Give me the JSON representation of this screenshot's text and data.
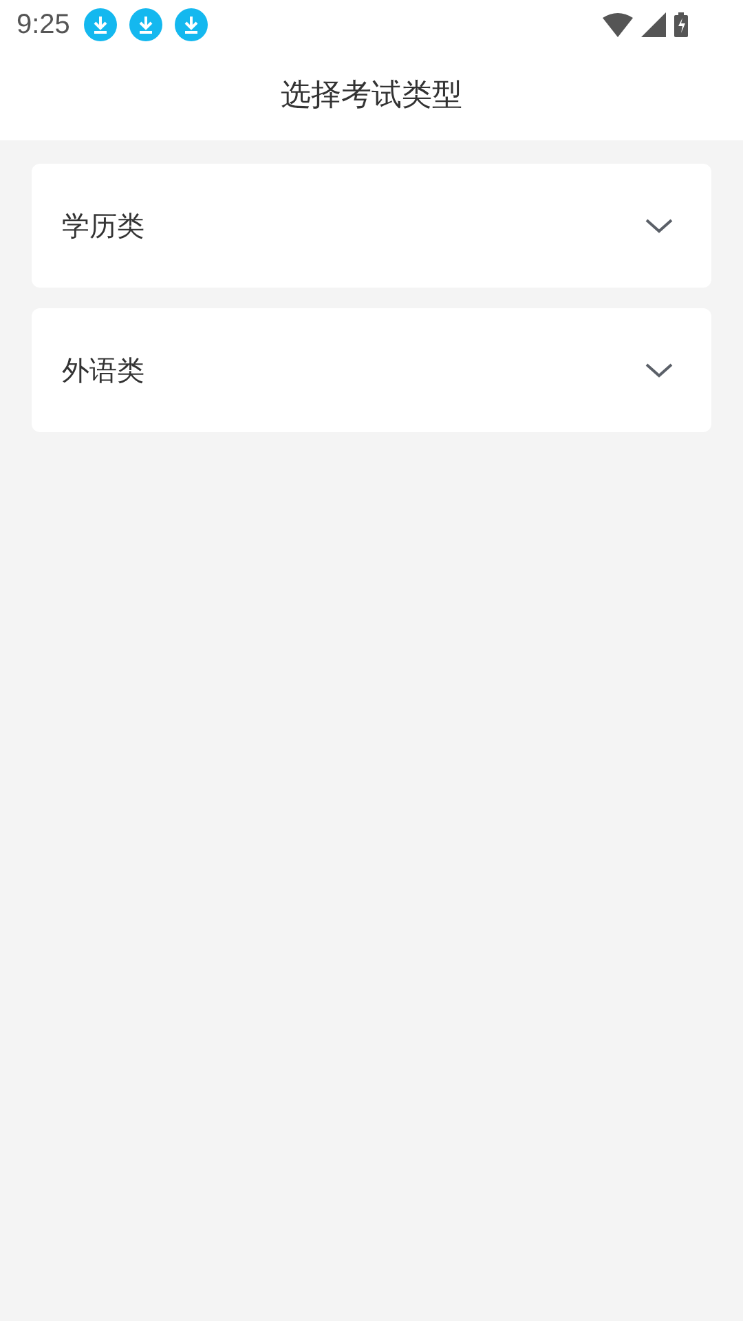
{
  "status_bar": {
    "time": "9:25",
    "notifications": [
      {
        "kind": "download"
      },
      {
        "kind": "download"
      },
      {
        "kind": "download"
      }
    ]
  },
  "header": {
    "title": "选择考试类型"
  },
  "categories": [
    {
      "label": "学历类",
      "expanded": false
    },
    {
      "label": "外语类",
      "expanded": false
    }
  ]
}
